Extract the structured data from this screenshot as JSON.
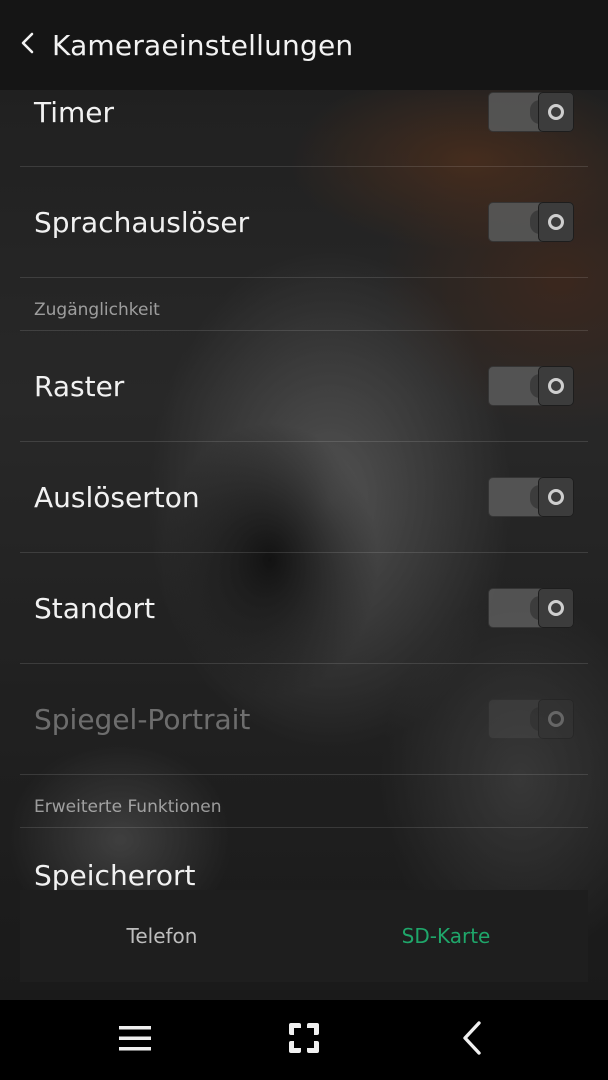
{
  "header": {
    "title": "Kameraeinstellungen",
    "back_icon": "chevron-left-icon"
  },
  "settings": [
    {
      "type": "row",
      "label": "Timer",
      "toggle": false,
      "enabled": true
    },
    {
      "type": "row",
      "label": "Sprachauslöser",
      "toggle": false,
      "enabled": true
    },
    {
      "type": "section",
      "label": "Zugänglichkeit"
    },
    {
      "type": "row",
      "label": "Raster",
      "toggle": false,
      "enabled": true
    },
    {
      "type": "row",
      "label": "Auslöserton",
      "toggle": false,
      "enabled": true
    },
    {
      "type": "row",
      "label": "Standort",
      "toggle": false,
      "enabled": true
    },
    {
      "type": "row",
      "label": "Spiegel-Portrait",
      "toggle": false,
      "enabled": false
    },
    {
      "type": "section",
      "label": "Erweiterte Funktionen"
    },
    {
      "type": "row",
      "label": "Speicherort"
    }
  ],
  "storage": {
    "options": [
      "Telefon",
      "SD-Karte"
    ],
    "selected": "SD-Karte",
    "active_color": "#1fa66a"
  },
  "navbar": {
    "menu_icon": "menu-icon",
    "home_icon": "home-icon",
    "back_icon": "back-icon"
  }
}
